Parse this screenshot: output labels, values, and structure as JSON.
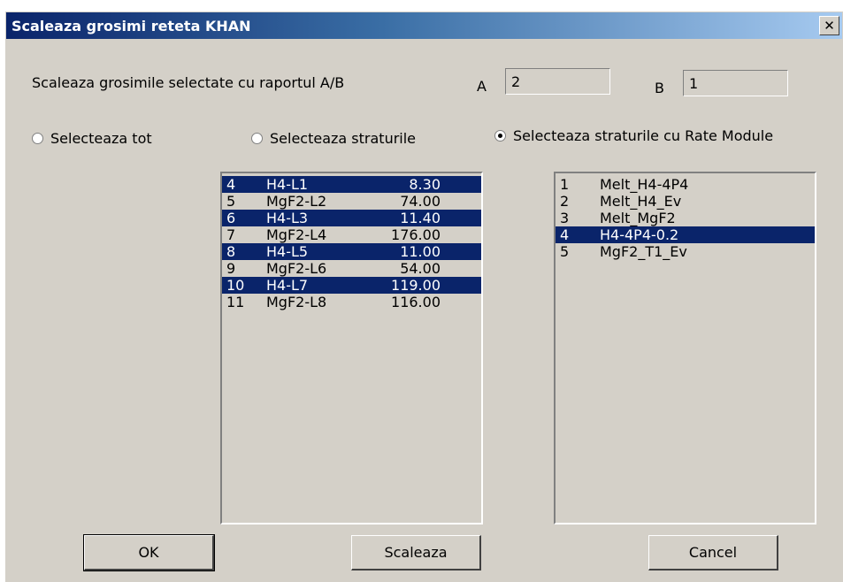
{
  "dialog": {
    "title": "Scaleaza grosimi reteta KHAN",
    "close_glyph": "✕",
    "ratio_label": "Scaleaza grosimile selectate cu raportul A/B",
    "a_label": "A",
    "a_value": "2",
    "b_label": "B",
    "b_value": "1"
  },
  "radios": [
    {
      "label": "Selecteaza tot",
      "checked": false
    },
    {
      "label": "Selecteaza straturile",
      "checked": false
    },
    {
      "label": "Selecteaza straturile cu Rate Module",
      "checked": true
    }
  ],
  "layers": [
    {
      "num": "4",
      "name": "H4-L1",
      "value": "8.30",
      "selected": true
    },
    {
      "num": "5",
      "name": "MgF2-L2",
      "value": "74.00",
      "selected": false
    },
    {
      "num": "6",
      "name": "H4-L3",
      "value": "11.40",
      "selected": true
    },
    {
      "num": "7",
      "name": "MgF2-L4",
      "value": "176.00",
      "selected": false
    },
    {
      "num": "8",
      "name": "H4-L5",
      "value": "11.00",
      "selected": true
    },
    {
      "num": "9",
      "name": "MgF2-L6",
      "value": "54.00",
      "selected": false
    },
    {
      "num": "10",
      "name": "H4-L7",
      "value": "119.00",
      "selected": true
    },
    {
      "num": "11",
      "name": "MgF2-L8",
      "value": "116.00",
      "selected": false
    }
  ],
  "modules": [
    {
      "num": "1",
      "name": "Melt_H4-4P4",
      "selected": false
    },
    {
      "num": "2",
      "name": "Melt_H4_Ev",
      "selected": false
    },
    {
      "num": "3",
      "name": "Melt_MgF2",
      "selected": false
    },
    {
      "num": "4",
      "name": "H4-4P4-0.2",
      "selected": true
    },
    {
      "num": "5",
      "name": "MgF2_T1_Ev",
      "selected": false
    }
  ],
  "buttons": {
    "ok": "OK",
    "scale": "Scaleaza",
    "cancel": "Cancel"
  },
  "colors": {
    "selection": "#0a246a",
    "face": "#d4d0c8"
  }
}
